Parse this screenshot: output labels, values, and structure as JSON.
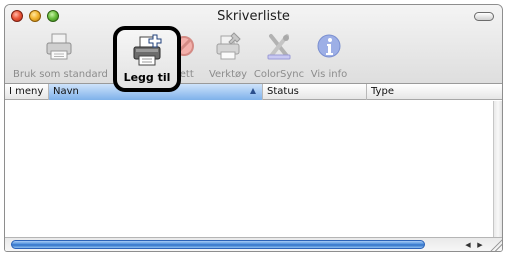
{
  "window": {
    "title": "Skriverliste"
  },
  "toolbar": {
    "items": [
      {
        "label": "Bruk som standard",
        "icon": "printer-default-icon"
      },
      {
        "label": "Legg til",
        "icon": "add-printer-icon"
      },
      {
        "label": "Slett",
        "visible_label": "lett",
        "icon": "delete-icon"
      },
      {
        "label": "Verktøy",
        "icon": "printer-utility-icon"
      },
      {
        "label": "ColorSync",
        "icon": "colorsync-icon"
      },
      {
        "label": "Vis info",
        "icon": "info-icon"
      }
    ]
  },
  "table": {
    "columns": [
      {
        "label": "I meny"
      },
      {
        "label": "Navn",
        "sorted": true
      },
      {
        "label": "Status"
      },
      {
        "label": "Type"
      }
    ],
    "rows": []
  },
  "colors": {
    "sorted_column": "#7fb1ea",
    "scroll_thumb": "#4f8fdc"
  }
}
